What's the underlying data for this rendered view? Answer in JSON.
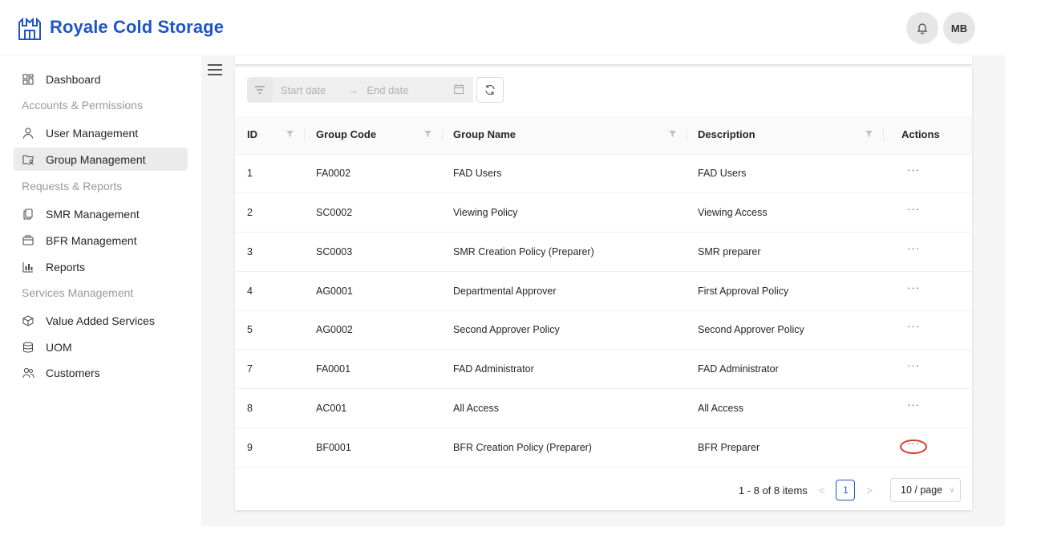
{
  "header": {
    "brand": "Royale Cold Storage",
    "avatar_initials": "MB"
  },
  "sidebar": {
    "dashboard": "Dashboard",
    "group_accounts": "Accounts & Permissions",
    "user_management": "User Management",
    "group_management": "Group Management",
    "group_requests": "Requests & Reports",
    "smr_management": "SMR Management",
    "bfr_management": "BFR Management",
    "reports": "Reports",
    "group_services": "Services Management",
    "value_added_services": "Value Added Services",
    "uom": "UOM",
    "customers": "Customers"
  },
  "filter": {
    "start_placeholder": "Start date",
    "end_placeholder": "End date"
  },
  "table": {
    "headers": {
      "id": "ID",
      "code": "Group Code",
      "name": "Group Name",
      "desc": "Description",
      "actions": "Actions"
    },
    "rows": [
      {
        "id": "1",
        "code": "FA0002",
        "name": "FAD Users",
        "desc": "FAD Users"
      },
      {
        "id": "2",
        "code": "SC0002",
        "name": "Viewing Policy",
        "desc": "Viewing Access"
      },
      {
        "id": "3",
        "code": "SC0003",
        "name": "SMR Creation Policy (Preparer)",
        "desc": "SMR preparer"
      },
      {
        "id": "4",
        "code": "AG0001",
        "name": "Departmental Approver",
        "desc": "First Approval Policy"
      },
      {
        "id": "5",
        "code": "AG0002",
        "name": "Second Approver Policy",
        "desc": "Second Approver Policy"
      },
      {
        "id": "7",
        "code": "FA0001",
        "name": "FAD Administrator",
        "desc": "FAD Administrator"
      },
      {
        "id": "8",
        "code": "AC001",
        "name": "All Access",
        "desc": "All Access"
      },
      {
        "id": "9",
        "code": "BF0001",
        "name": "BFR Creation Policy (Preparer)",
        "desc": "BFR Preparer"
      }
    ],
    "actions_glyph": "···"
  },
  "pagination": {
    "summary": "1 - 8 of 8 items",
    "current_page": "1",
    "page_size": "10 / page"
  },
  "colors": {
    "brand": "#1f55c9",
    "highlight": "#d93a2b"
  }
}
